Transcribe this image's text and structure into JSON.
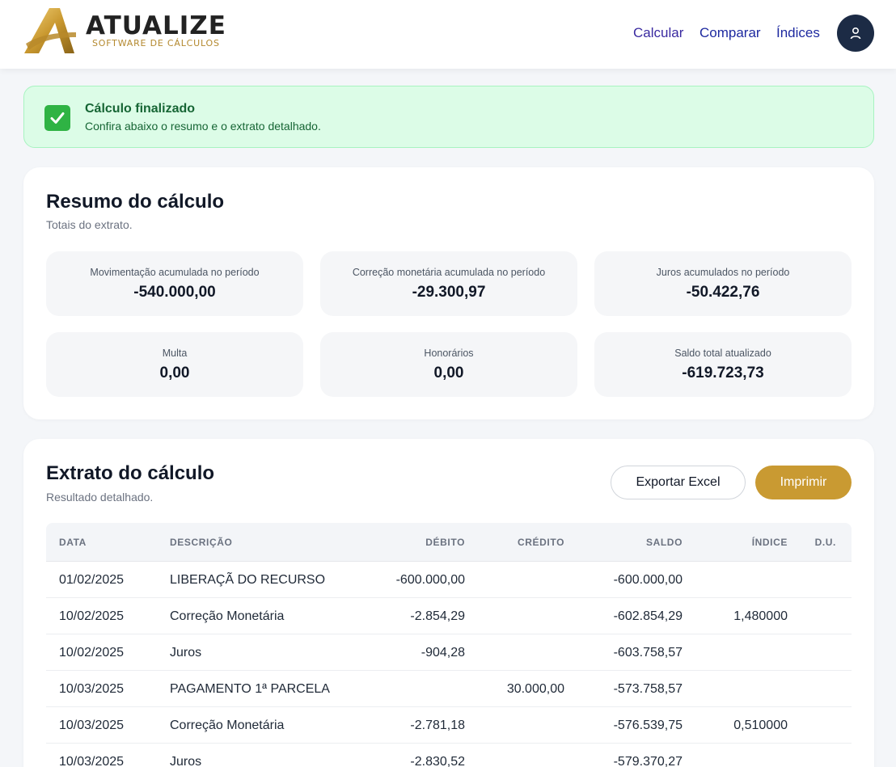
{
  "header": {
    "brand": {
      "name": "ATUALIZE",
      "tagline": "SOFTWARE DE CÁLCULOS"
    },
    "nav": [
      "Calcular",
      "Comparar",
      "Índices"
    ]
  },
  "banner": {
    "title": "Cálculo finalizado",
    "text": "Confira abaixo o resumo e o extrato detalhado."
  },
  "resumo": {
    "title": "Resumo do cálculo",
    "subtitle": "Totais do extrato.",
    "stats": [
      {
        "label": "Movimentação acumulada no período",
        "value": "-540.000,00"
      },
      {
        "label": "Correção monetária acumulada no período",
        "value": "-29.300,97"
      },
      {
        "label": "Juros acumulados no período",
        "value": "-50.422,76"
      },
      {
        "label": "Multa",
        "value": "0,00"
      },
      {
        "label": "Honorários",
        "value": "0,00"
      },
      {
        "label": "Saldo total atualizado",
        "value": "-619.723,73"
      }
    ]
  },
  "extrato": {
    "title": "Extrato do cálculo",
    "subtitle": "Resultado detalhado.",
    "export_label": "Exportar Excel",
    "print_label": "Imprimir",
    "columns": [
      "DATA",
      "DESCRIÇÃO",
      "DÉBITO",
      "CRÉDITO",
      "SALDO",
      "ÍNDICE",
      "D.U."
    ],
    "rows": [
      [
        "01/02/2025",
        "LIBERAÇÃ DO RECURSO",
        "-600.000,00",
        "",
        "-600.000,00",
        "",
        ""
      ],
      [
        "10/02/2025",
        "Correção Monetária",
        "-2.854,29",
        "",
        "-602.854,29",
        "1,480000",
        ""
      ],
      [
        "10/02/2025",
        "Juros",
        "-904,28",
        "",
        "-603.758,57",
        "",
        ""
      ],
      [
        "10/03/2025",
        "PAGAMENTO 1ª PARCELA",
        "",
        "30.000,00",
        "-573.758,57",
        "",
        ""
      ],
      [
        "10/03/2025",
        "Correção Monetária",
        "-2.781,18",
        "",
        "-576.539,75",
        "0,510000",
        ""
      ],
      [
        "10/03/2025",
        "Juros",
        "-2.830,52",
        "",
        "-579.370,27",
        "",
        ""
      ]
    ]
  },
  "colors": {
    "brand_gold": "#c99a32",
    "avatar_bg": "#1c2b45",
    "success_bg": "#dcfce7",
    "success_text": "#166534"
  },
  "icons": {
    "banner": "check-icon",
    "avatar": "user-icon",
    "logo": "logo-a-mark"
  }
}
